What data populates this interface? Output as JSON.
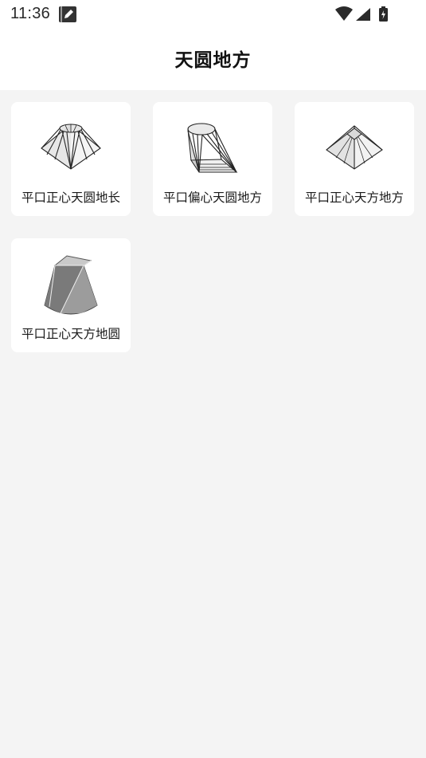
{
  "status_bar": {
    "time": "11:36",
    "icons": [
      "edit-note-icon",
      "wifi-icon",
      "cellular-signal-icon",
      "battery-charging-icon"
    ]
  },
  "header": {
    "title": "天圆地方"
  },
  "grid": {
    "items": [
      {
        "label": "平口正心天圆地长",
        "icon": "round-top-rectangular-base-icon"
      },
      {
        "label": "平口偏心天圆地方",
        "icon": "round-top-offset-square-base-icon"
      },
      {
        "label": "平口正心天方地方",
        "icon": "square-top-square-base-icon"
      },
      {
        "label": "平口正心天方地圆",
        "icon": "square-top-round-base-icon"
      }
    ]
  }
}
